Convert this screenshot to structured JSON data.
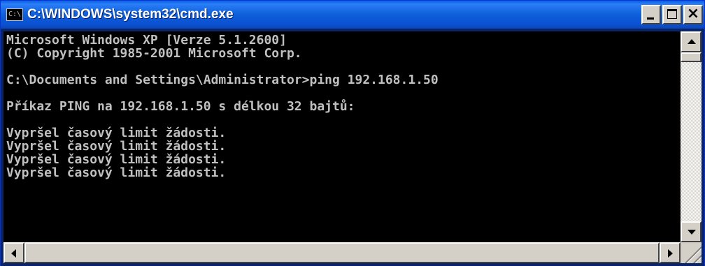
{
  "window": {
    "title": "C:\\WINDOWS\\system32\\cmd.exe",
    "icon_label": "C:\\"
  },
  "console": {
    "lines": [
      "Microsoft Windows XP [Verze 5.1.2600]",
      "(C) Copyright 1985-2001 Microsoft Corp.",
      "",
      "C:\\Documents and Settings\\Administrator>ping 192.168.1.50",
      "",
      "Příkaz PING na 192.168.1.50 s délkou 32 bajtů:",
      "",
      "Vypršel časový limit žádosti.",
      "Vypršel časový limit žádosti.",
      "Vypršel časový limit žádosti.",
      "Vypršel časový limit žádosti."
    ]
  },
  "icons": {
    "window_icon": "console-icon",
    "minimize": "minimize-icon",
    "maximize": "maximize-icon",
    "close": "close-icon",
    "scroll_up": "arrow-up-icon",
    "scroll_down": "arrow-down-icon",
    "scroll_left": "arrow-left-icon",
    "scroll_right": "arrow-right-icon",
    "resize_grip": "resize-grip-icon"
  },
  "colors": {
    "titlebar": "#0a5fe3",
    "console_bg": "#000000",
    "console_text": "#c0c0c0",
    "chrome": "#d4d0c8"
  }
}
